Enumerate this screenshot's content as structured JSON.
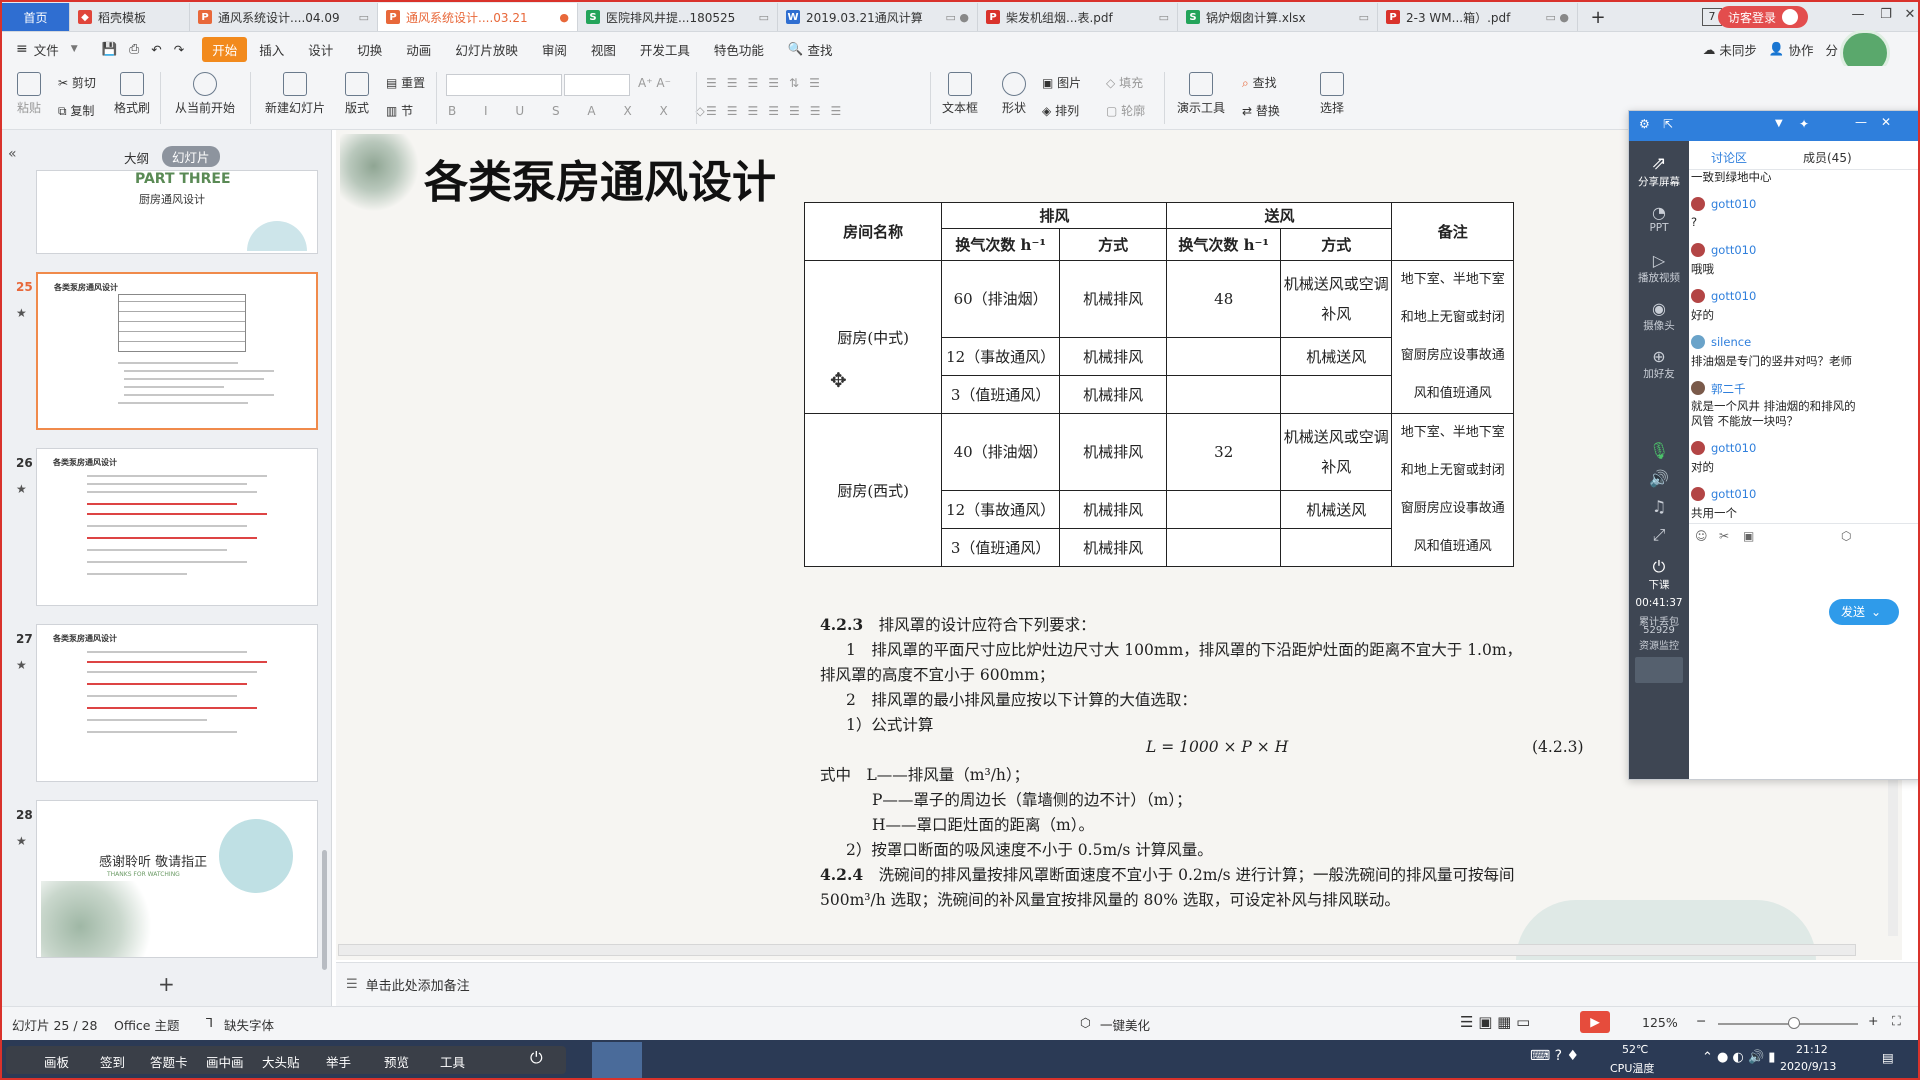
{
  "tabs": [
    {
      "label": "首页",
      "kind": "home"
    },
    {
      "label": "稻壳模板",
      "icon": "docer-icon",
      "color": "#e0453a"
    },
    {
      "label": "通风系统设计....04.09",
      "icon": "ppt-icon",
      "color": "#e8683a"
    },
    {
      "label": "通风系统设计....03.21",
      "icon": "ppt-icon",
      "color": "#e8683a",
      "active": true
    },
    {
      "label": "医院排风井提...180525",
      "icon": "sheet-icon",
      "color": "#23a45a"
    },
    {
      "label": "2019.03.21通风计算",
      "icon": "word-icon",
      "color": "#2f6ed1"
    },
    {
      "label": "柴发机组烟...表.pdf",
      "icon": "pdf-icon",
      "color": "#d9322b"
    },
    {
      "label": "锅炉烟囱计算.xlsx",
      "icon": "sheet-icon",
      "color": "#23a45a"
    },
    {
      "label": "2-3 WM...箱）.pdf",
      "icon": "pdf-icon",
      "color": "#d9322b"
    }
  ],
  "titlebar": {
    "new_tab": "+",
    "page_count": "7",
    "login": "访客登录"
  },
  "menubar": {
    "file": "文件",
    "items": [
      "开始",
      "插入",
      "设计",
      "切换",
      "动画",
      "幻灯片放映",
      "审阅",
      "视图",
      "开发工具",
      "特色功能"
    ],
    "search": "查找",
    "right": [
      "未同步",
      "协作",
      "分"
    ]
  },
  "ribbon": {
    "paste": "粘贴",
    "cut": "剪切",
    "copy": "复制",
    "format_painter": "格式刷",
    "play_from_start": "从当前开始",
    "new_slide": "新建幻灯片",
    "layout": "版式",
    "reset": "重置",
    "section": "节",
    "textbox": "文本框",
    "shape": "形状",
    "picture": "图片",
    "arrange": "排列",
    "fill": "填充",
    "outline": "轮廓",
    "presenter_tools": "演示工具",
    "find": "查找",
    "replace": "替换",
    "select": "选择"
  },
  "leftpanel": {
    "tab_outline": "大纲",
    "tab_slides": "幻灯片",
    "slides": [
      {
        "num": "",
        "title": "PART THREE",
        "subtitle": "厨房通风设计"
      },
      {
        "num": "25",
        "title": "各类泵房通风设计",
        "selected": true
      },
      {
        "num": "26",
        "title": "各类泵房通风设计"
      },
      {
        "num": "27",
        "title": "各类泵房通风设计"
      },
      {
        "num": "28",
        "title": "感谢聆听 敬请指正",
        "subtitle": "THANKS FOR WATCHING"
      }
    ],
    "add_slide": "+"
  },
  "slide": {
    "title": "各类泵房通风设计",
    "table": {
      "h_room": "房间名称",
      "h_exhaust": "排风",
      "h_supply": "送风",
      "h_note": "备注",
      "h_rate": "换气次数 h⁻¹",
      "h_mode": "方式",
      "groups": [
        {
          "room": "厨房(中式)",
          "rows": [
            {
              "ex_rate": "60（排油烟）",
              "ex_mode": "机械排风",
              "sup_rate": "48",
              "sup_mode": "机械送风或空调补风"
            },
            {
              "ex_rate": "12（事故通风）",
              "ex_mode": "机械排风",
              "sup_rate": "",
              "sup_mode": "机械送风"
            },
            {
              "ex_rate": "3（值班通风）",
              "ex_mode": "机械排风",
              "sup_rate": "",
              "sup_mode": ""
            }
          ],
          "note": "地下室、半地下室和地上无窗或封闭窗厨房应设事故通风和值班通风"
        },
        {
          "room": "厨房(西式)",
          "rows": [
            {
              "ex_rate": "40（排油烟）",
              "ex_mode": "机械排风",
              "sup_rate": "32",
              "sup_mode": "机械送风或空调补风"
            },
            {
              "ex_rate": "12（事故通风）",
              "ex_mode": "机械排风",
              "sup_rate": "",
              "sup_mode": "机械送风"
            },
            {
              "ex_rate": "3（值班通风）",
              "ex_mode": "机械排风",
              "sup_rate": "",
              "sup_mode": ""
            }
          ],
          "note": "地下室、半地下室和地上无窗或封闭窗厨房应设事故通风和值班通风"
        }
      ]
    },
    "text": {
      "l1_num": "4.2.3",
      "l1": "排风罩的设计应符合下列要求：",
      "l2": "1　排风罩的平面尺寸应比炉灶边尺寸大 100mm，排风罩的下沿距炉灶面的距离不宜大于 1.0m，",
      "l3": "排风罩的高度不宜小于 600mm；",
      "l4": "2　排风罩的最小排风量应按以下计算的大值选取：",
      "l5": "1）公式计算",
      "formula": "L = 1000 × P × H",
      "formula_no": "(4.2.3)",
      "l7": "式中　L——排风量（m³/h）；",
      "l8": "P——罩子的周边长（靠墙侧的边不计）（m）；",
      "l9": "H——罩口距灶面的距离（m）。",
      "l10": "2）按罩口断面的吸风速度不小于 0.5m/s 计算风量。",
      "l11_num": "4.2.4",
      "l11": "洗碗间的排风量按排风罩断面速度不宜小于 0.2m/s 进行计算；一般洗碗间的排风量可按每间",
      "l12": "500m³/h 选取；洗碗间的补风量宜按排风量的 80% 选取，可设定补风与排风联动。"
    }
  },
  "notes": {
    "placeholder": "单击此处添加备注"
  },
  "statusbar": {
    "slide_info": "幻灯片 25 / 28",
    "theme": "Office 主题",
    "missing_font": "缺失字体",
    "beautify": "一键美化",
    "zoom": "125%"
  },
  "taskbar": {
    "items": [
      "画板",
      "签到",
      "答题卡",
      "画中画",
      "大头贴",
      "举手",
      "预览",
      "工具"
    ],
    "temp": "52℃",
    "cpu": "CPU温度",
    "time": "21:12",
    "date": "2020/9/13"
  },
  "chat": {
    "tabs": {
      "discuss": "讨论区",
      "members": "成员(45)"
    },
    "side": {
      "share": "分享屏幕",
      "ppt": "PPT",
      "video": "播放视频",
      "camera": "摄像头",
      "add_friend": "加好友",
      "end": "下课",
      "timer": "00:41:37",
      "cumulative": "累计丢包",
      "packets": "52929",
      "monitor": "资源监控"
    },
    "messages": [
      {
        "user": "",
        "text": "一致到绿地中心"
      },
      {
        "user": "gott010",
        "text": "?"
      },
      {
        "user": "gott010",
        "text": "哦哦"
      },
      {
        "user": "gott010",
        "text": "好的"
      },
      {
        "user": "silence",
        "text": "排油烟是专门的竖井对吗？老师"
      },
      {
        "user": "郭二千",
        "text": "就是一个风井  排油烟的和排风的风管 不能放一块吗？"
      },
      {
        "user": "gott010",
        "text": "对的"
      },
      {
        "user": "gott010",
        "text": "共用一个"
      }
    ],
    "send": "发送"
  }
}
